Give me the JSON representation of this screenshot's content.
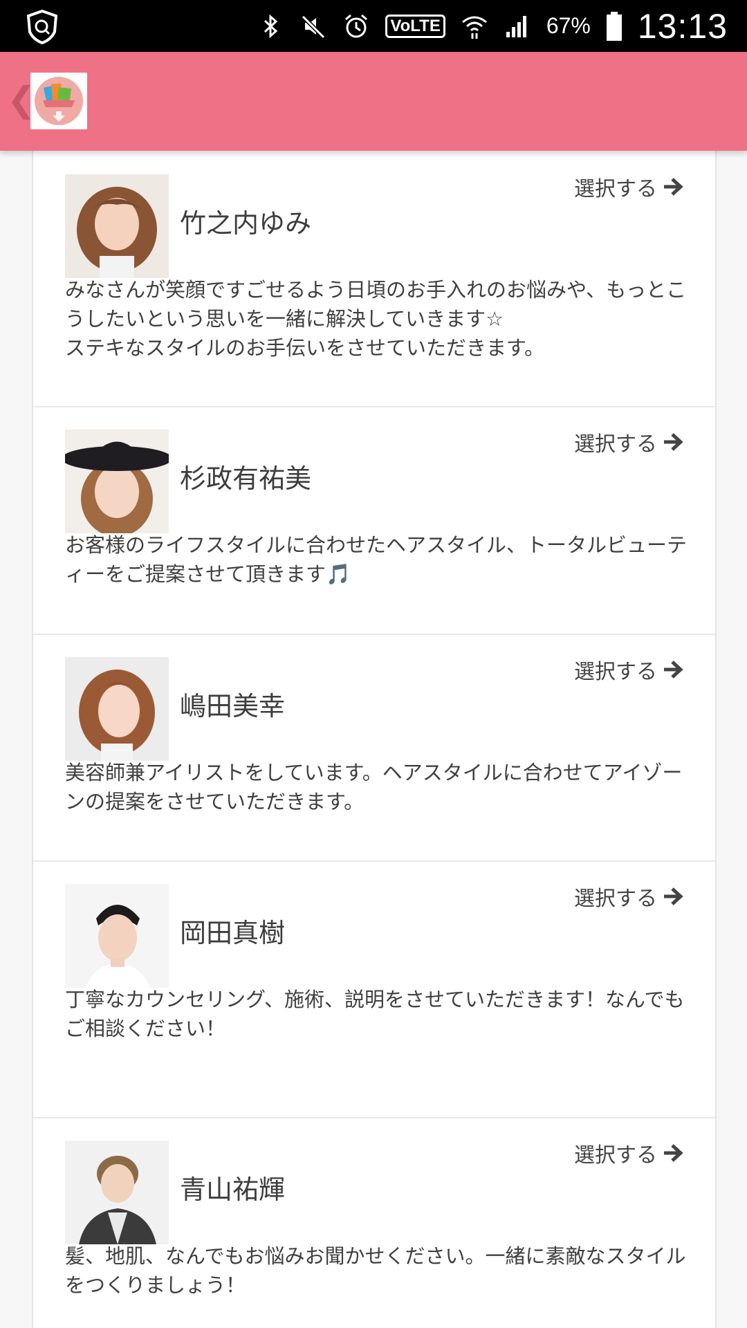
{
  "status_bar": {
    "battery": "67%",
    "time": "13:13",
    "volte": "VoLTE"
  },
  "app_bar": {
    "back_icon": "chevron-left-icon",
    "logo_icon": "app-logo-icon"
  },
  "staff": [
    {
      "name": "竹之内ゆみ",
      "select_label": "選択する",
      "description": "みなさんが笑顔ですごせるよう日頃のお手入れのお悩みや、もっとこうしたいという思いを一緒に解決していきます☆\nステキなスタイルのお手伝いをさせていただきます。"
    },
    {
      "name": "杉政有祐美",
      "select_label": "選択する",
      "description": "お客様のライフスタイルに合わせたヘアスタイル、トータルビューティーをご提案させて頂きます🎵"
    },
    {
      "name": "嶋田美幸",
      "select_label": "選択する",
      "description": "美容師兼アイリストをしています。ヘアスタイルに合わせてアイゾーンの提案をさせていただきます。"
    },
    {
      "name": "岡田真樹",
      "select_label": "選択する",
      "description": "丁寧なカウンセリング、施術、説明をさせていただきます！なんでもご相談ください！"
    },
    {
      "name": "青山祐輝",
      "select_label": "選択する",
      "description": "髪、地肌、なんでもお悩みお聞かせください。一緒に素敵なスタイルをつくりましょう！"
    }
  ],
  "colors": {
    "app_bar": "#ef7186",
    "status_bar": "#000000",
    "text": "#444444"
  }
}
